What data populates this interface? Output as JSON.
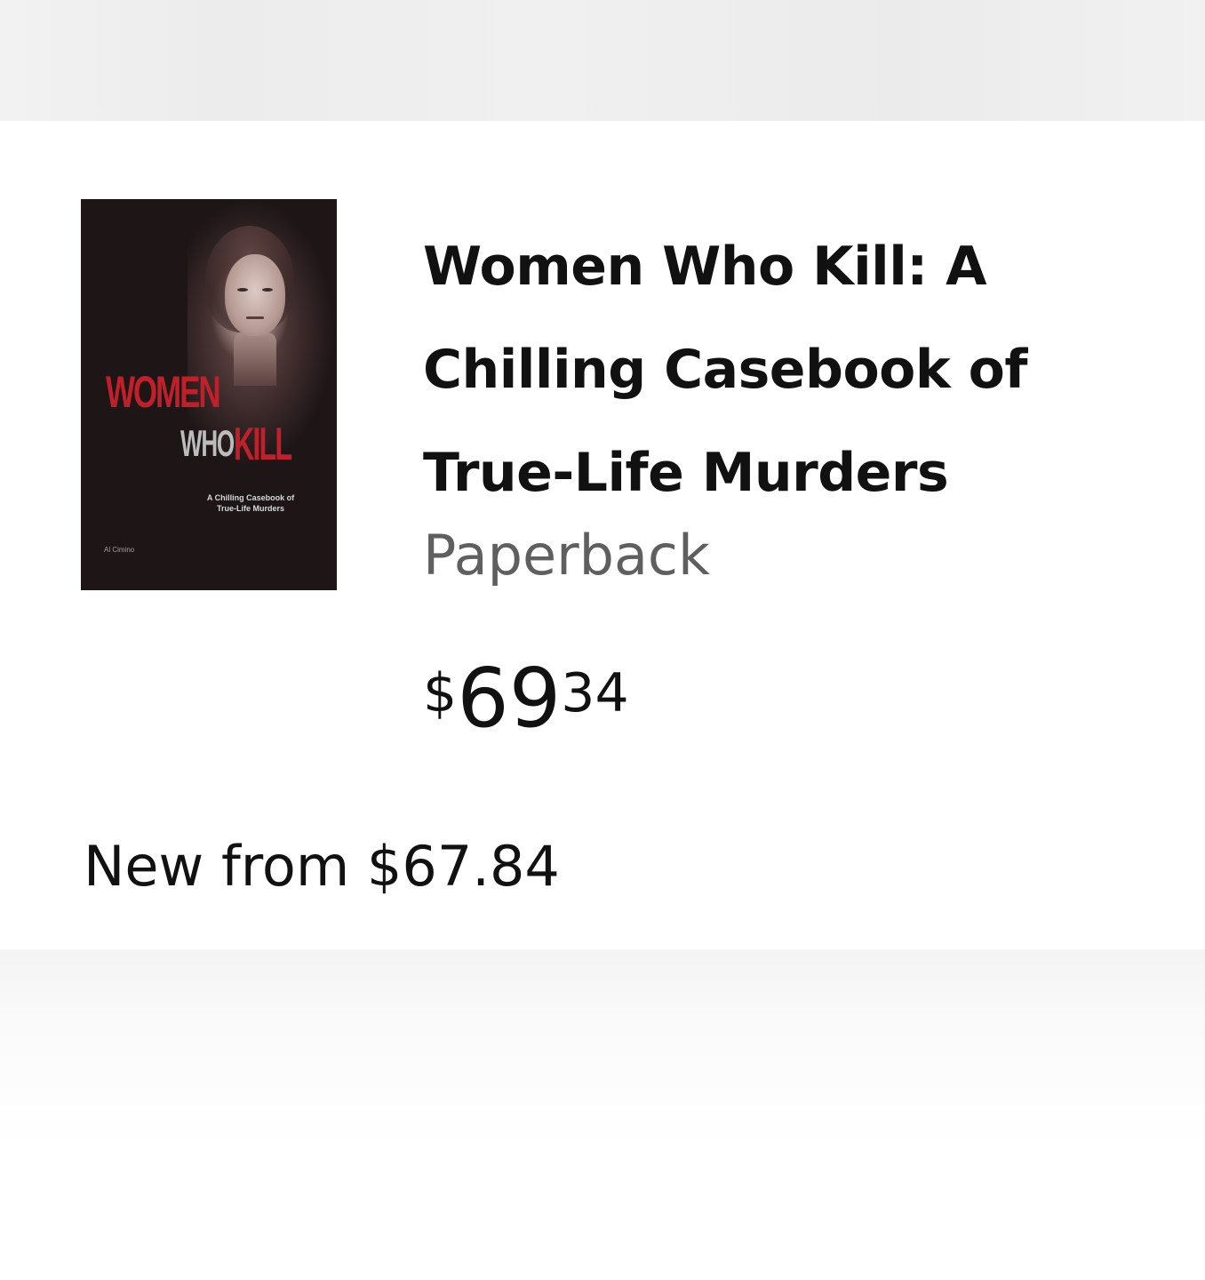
{
  "product": {
    "title": "Women Who Kill: A\nChilling Casebook of\nTrue-Life Murders",
    "format": "Paperback",
    "price": {
      "symbol": "$",
      "whole": "69",
      "fraction": "34"
    },
    "offer": "New from $67.84"
  },
  "cover": {
    "line1": "WOMEN",
    "line2a": "WHO",
    "line2b": "KILL",
    "subtitle": "A Chilling Casebook of\nTrue-Life Murders",
    "author": "Al Cimino"
  },
  "colors": {
    "title": "#111111",
    "format": "#5f5f5f",
    "cover_background": "#1d1516",
    "cover_accent": "#c0202a"
  }
}
